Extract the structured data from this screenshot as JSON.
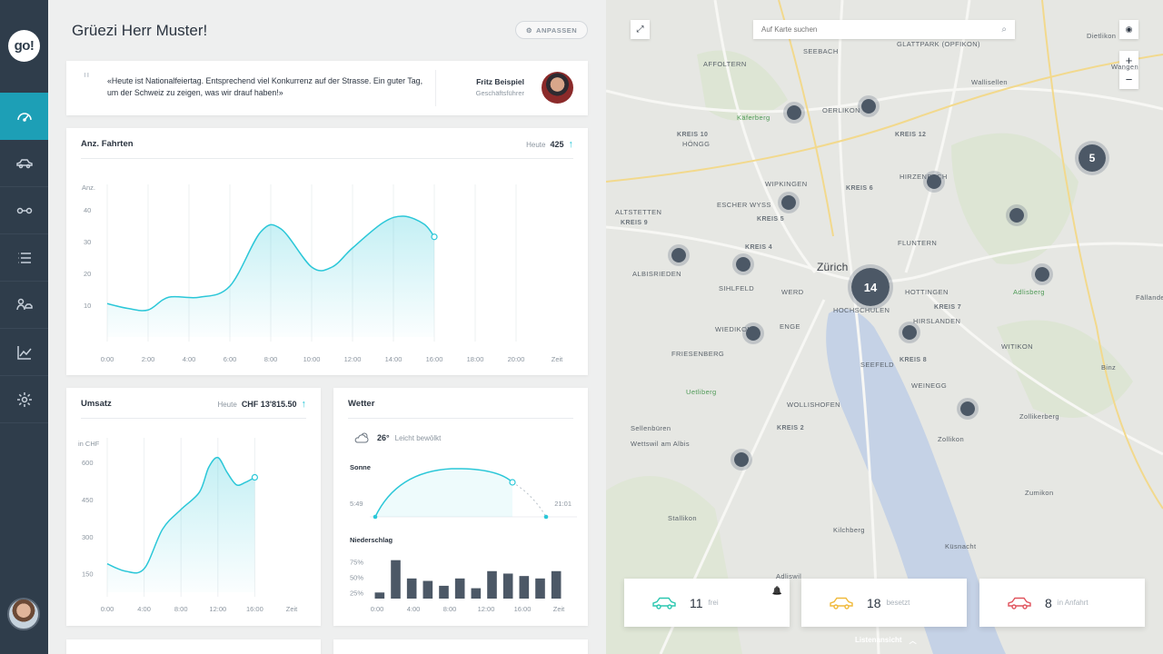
{
  "app": {
    "logo_text": "go!"
  },
  "sidebar": {
    "items": [
      {
        "name": "dashboard",
        "icon": "speedometer-icon",
        "active": true
      },
      {
        "name": "vehicles",
        "icon": "car-icon"
      },
      {
        "name": "connections",
        "icon": "link-icon"
      },
      {
        "name": "list",
        "icon": "list-icon"
      },
      {
        "name": "drivers",
        "icon": "driver-icon"
      },
      {
        "name": "analytics",
        "icon": "chart-icon"
      },
      {
        "name": "settings",
        "icon": "gear-icon"
      }
    ]
  },
  "header": {
    "greeting": "Grüezi Herr Muster!",
    "customize_label": "ANPASSEN"
  },
  "quote": {
    "mark": "\"",
    "text": "«Heute ist Nationalfeiertag. Entsprechend viel Konkurrenz auf der Strasse. Ein guter Tag, um der Schweiz zu zeigen, was wir drauf haben!»",
    "author": "Fritz Beispiel",
    "role": "Geschäftsführer"
  },
  "trips": {
    "title": "Anz. Fahrten",
    "today_label": "Heute",
    "today_value": "425",
    "chart_data": {
      "type": "area",
      "title": "Anz. Fahrten",
      "ylabel": "Anz.",
      "xlabel": "Zeit",
      "categories": [
        "0:00",
        "2:00",
        "4:00",
        "6:00",
        "8:00",
        "10:00",
        "12:00",
        "14:00",
        "16:00",
        "18:00",
        "20:00",
        "Zeit"
      ],
      "y_ticks": [
        "40",
        "30",
        "20",
        "10"
      ],
      "ylim": [
        0,
        48
      ],
      "x": [
        0,
        1,
        2,
        3,
        4,
        5,
        6,
        7,
        8,
        9,
        10,
        11,
        12,
        13,
        14,
        15,
        16
      ],
      "values": [
        10.5,
        9,
        8.5,
        12.5,
        12.5,
        16,
        33,
        34,
        22,
        22,
        28,
        36,
        38,
        35.5,
        31.5
      ],
      "x_hours": [
        0,
        1,
        2,
        3,
        4.5,
        6,
        7.5,
        8.5,
        10,
        11,
        12,
        13.5,
        14.5,
        15.5,
        16
      ],
      "grid": true
    }
  },
  "revenue": {
    "title": "Umsatz",
    "today_label": "Heute",
    "today_value": "CHF 13'815.50",
    "chart_data": {
      "type": "area",
      "title": "Umsatz",
      "ylabel": "in CHF",
      "xlabel": "Zeit",
      "categories": [
        "0:00",
        "4:00",
        "8:00",
        "12:00",
        "16:00",
        "Zeit"
      ],
      "y_ticks": [
        "600",
        "450",
        "300",
        "150"
      ],
      "ylim": [
        75,
        700
      ],
      "x_hours": [
        0,
        2,
        4,
        6,
        8,
        10,
        11,
        12,
        13,
        14,
        15,
        16
      ],
      "values": [
        190,
        160,
        170,
        330,
        410,
        480,
        580,
        620,
        560,
        510,
        520,
        540
      ],
      "grid": true
    }
  },
  "weather": {
    "title": "Wetter",
    "icon": "partly-cloudy-icon",
    "temperature": "26°",
    "condition": "Leicht bewölkt",
    "sun_label": "Sonne",
    "sunrise": "5:49",
    "sunset": "21:01",
    "precip_label": "Niederschlag",
    "chart_data": {
      "type": "bar",
      "title": "Niederschlag",
      "categories": [
        "0:00",
        "4:00",
        "8:00",
        "12:00",
        "16:00",
        "Zeit"
      ],
      "y_ticks": [
        "75%",
        "50%",
        "25%"
      ],
      "ylim": [
        15,
        85
      ],
      "values": [
        25,
        78,
        48,
        44,
        36,
        48,
        32,
        60,
        56,
        52,
        48,
        60
      ],
      "grid": false
    }
  },
  "map": {
    "search_placeholder": "Auf Karte suchen",
    "places": [
      {
        "name": "SEEBACH",
        "cls": ""
      },
      {
        "name": "AFFOLTERN",
        "cls": ""
      },
      {
        "name": "OERLIKON",
        "cls": ""
      },
      {
        "name": "HÖNGG",
        "cls": ""
      },
      {
        "name": "KREIS 10",
        "cls": "district"
      },
      {
        "name": "KREIS 12",
        "cls": "district"
      },
      {
        "name": "KREIS 6",
        "cls": "district"
      },
      {
        "name": "HIRZENBACH",
        "cls": ""
      },
      {
        "name": "WIPKINGEN",
        "cls": ""
      },
      {
        "name": "ESCHER WYSS",
        "cls": ""
      },
      {
        "name": "KREIS 5",
        "cls": "district"
      },
      {
        "name": "ALTSTETTEN",
        "cls": ""
      },
      {
        "name": "KREIS 9",
        "cls": "district"
      },
      {
        "name": "ALBISRIEDEN",
        "cls": ""
      },
      {
        "name": "KREIS 4",
        "cls": "district"
      },
      {
        "name": "SIHLFELD",
        "cls": ""
      },
      {
        "name": "FLUNTERN",
        "cls": ""
      },
      {
        "name": "Zürich",
        "cls": "major"
      },
      {
        "name": "HOTTINGEN",
        "cls": ""
      },
      {
        "name": "KREIS 7",
        "cls": "district"
      },
      {
        "name": "WERD",
        "cls": ""
      },
      {
        "name": "HOCHSCHULEN",
        "cls": ""
      },
      {
        "name": "HIRSLANDEN",
        "cls": ""
      },
      {
        "name": "ENGE",
        "cls": ""
      },
      {
        "name": "WIEDIKON",
        "cls": ""
      },
      {
        "name": "FRIESENBERG",
        "cls": ""
      },
      {
        "name": "WITIKON",
        "cls": ""
      },
      {
        "name": "SEEFELD",
        "cls": ""
      },
      {
        "name": "KREIS 8",
        "cls": "district"
      },
      {
        "name": "WEINEGG",
        "cls": ""
      },
      {
        "name": "Uetliberg",
        "cls": "green"
      },
      {
        "name": "WOLLISHOFEN",
        "cls": ""
      },
      {
        "name": "KREIS 2",
        "cls": "district"
      },
      {
        "name": "Zollikerberg",
        "cls": ""
      },
      {
        "name": "Zollikon",
        "cls": ""
      },
      {
        "name": "Adliswil",
        "cls": ""
      },
      {
        "name": "Kilchberg",
        "cls": ""
      },
      {
        "name": "Küsnacht",
        "cls": ""
      },
      {
        "name": "Sellenbüren",
        "cls": ""
      },
      {
        "name": "Wettswil am Albis",
        "cls": ""
      },
      {
        "name": "Stallikon",
        "cls": ""
      },
      {
        "name": "Zumikon",
        "cls": ""
      },
      {
        "name": "Binz",
        "cls": ""
      },
      {
        "name": "Wallisellen",
        "cls": ""
      },
      {
        "name": "Dietlikon",
        "cls": ""
      },
      {
        "name": "Wangen",
        "cls": ""
      },
      {
        "name": "Käferberg",
        "cls": "green"
      },
      {
        "name": "Adlisberg",
        "cls": "green"
      },
      {
        "name": "Fällanden",
        "cls": ""
      },
      {
        "name": "GLATTPARK (OPFIKON)",
        "cls": ""
      }
    ],
    "clusters": [
      {
        "label": "14"
      },
      {
        "label": "5"
      }
    ],
    "status": [
      {
        "count": "11",
        "label": "frei",
        "color": "#2bc7b0"
      },
      {
        "count": "18",
        "label": "besetzt",
        "color": "#f0b93a"
      },
      {
        "count": "8",
        "label": "in Anfahrt",
        "color": "#e0535d"
      }
    ],
    "list_view_label": "Listenansicht"
  },
  "colors": {
    "accent": "#2bc7d8",
    "sidebar": "#2f3d4b",
    "active": "#1d9fb6"
  }
}
